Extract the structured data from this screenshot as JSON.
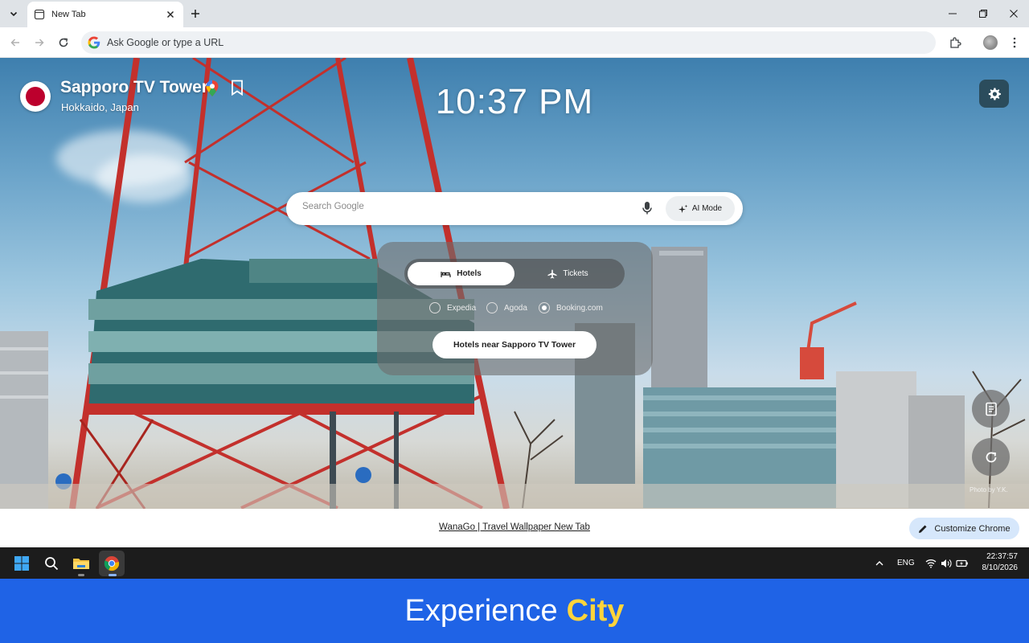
{
  "browser": {
    "tab_title": "New Tab",
    "omnibox_placeholder": "Ask Google or type a URL"
  },
  "ntp": {
    "location_title": "Sapporo TV Tower",
    "location_subtitle": "Hokkaido, Japan",
    "time": "10:37 PM",
    "search_placeholder": "Search Google",
    "ai_mode_label": "AI Mode",
    "tabs": [
      {
        "label": "Hotels",
        "icon": "bed-icon",
        "active": true
      },
      {
        "label": "Tickets",
        "icon": "plane-icon",
        "active": false
      }
    ],
    "providers": [
      {
        "label": "Expedia",
        "selected": false
      },
      {
        "label": "Agoda",
        "selected": false
      },
      {
        "label": "Booking.com",
        "selected": true
      }
    ],
    "action_button": "Hotels near Sapporo TV Tower",
    "photo_credit": "Photo by Y.K.",
    "footer_link": "WanaGo | Travel Wallpaper New Tab",
    "customize_label": "Customize Chrome"
  },
  "taskbar": {
    "language": "ENG",
    "time": "22:37:57",
    "date": "8/10/2026"
  },
  "banner": {
    "prefix": "Experience",
    "highlight": "City"
  },
  "colors": {
    "banner_bg": "#1f63e6",
    "banner_highlight": "#ffd43b",
    "flag_red": "#bc002d",
    "tower_red": "#c3302c",
    "customize_bg": "#d6e7fb"
  }
}
